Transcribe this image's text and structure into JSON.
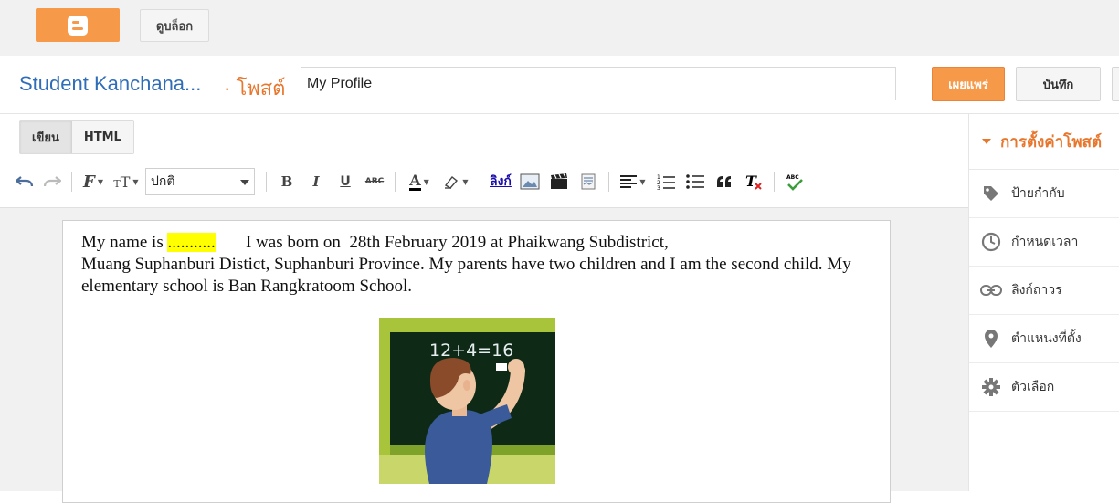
{
  "topbar": {
    "view_blog_label": "ดูบล็อก"
  },
  "header": {
    "blog_name": "Student Kanchana...",
    "post_label": "· โพสต์",
    "title_value": "My Profile",
    "publish_label": "เผยแพร่",
    "save_label": "บันทึก"
  },
  "editor_tabs": [
    {
      "label": "เขียน"
    },
    {
      "label": "HTML"
    }
  ],
  "toolbar": {
    "format_value": "ปกติ",
    "link_label": "ลิงก์"
  },
  "content": {
    "p1_before": "My name is ",
    "p1_highlight": "...........",
    "p1_after": "       I was born on  28th February 2019 at Phaikwang Subdistrict,",
    "p2": "Muang Suphanburi Distict, Suphanburi Province.  My parents have two children and I am the second child. My elementary school is Ban Rangkratoom School.",
    "image_equation": "12+4=16"
  },
  "sidebar": {
    "heading": "การตั้งค่าโพสต์",
    "items": [
      {
        "label": "ป้ายกำกับ",
        "icon": "tag-icon"
      },
      {
        "label": "กำหนดเวลา",
        "icon": "clock-icon"
      },
      {
        "label": "ลิงก์ถาวร",
        "icon": "link-icon"
      },
      {
        "label": "ตำแหน่งที่ตั้ง",
        "icon": "location-pin-icon"
      },
      {
        "label": "ตัวเลือก",
        "icon": "gear-icon"
      }
    ]
  },
  "colors": {
    "accent": "#f69a4a",
    "blog_blue": "#2f6db8",
    "orange_text": "#e8772e",
    "highlight": "#ffff00"
  }
}
